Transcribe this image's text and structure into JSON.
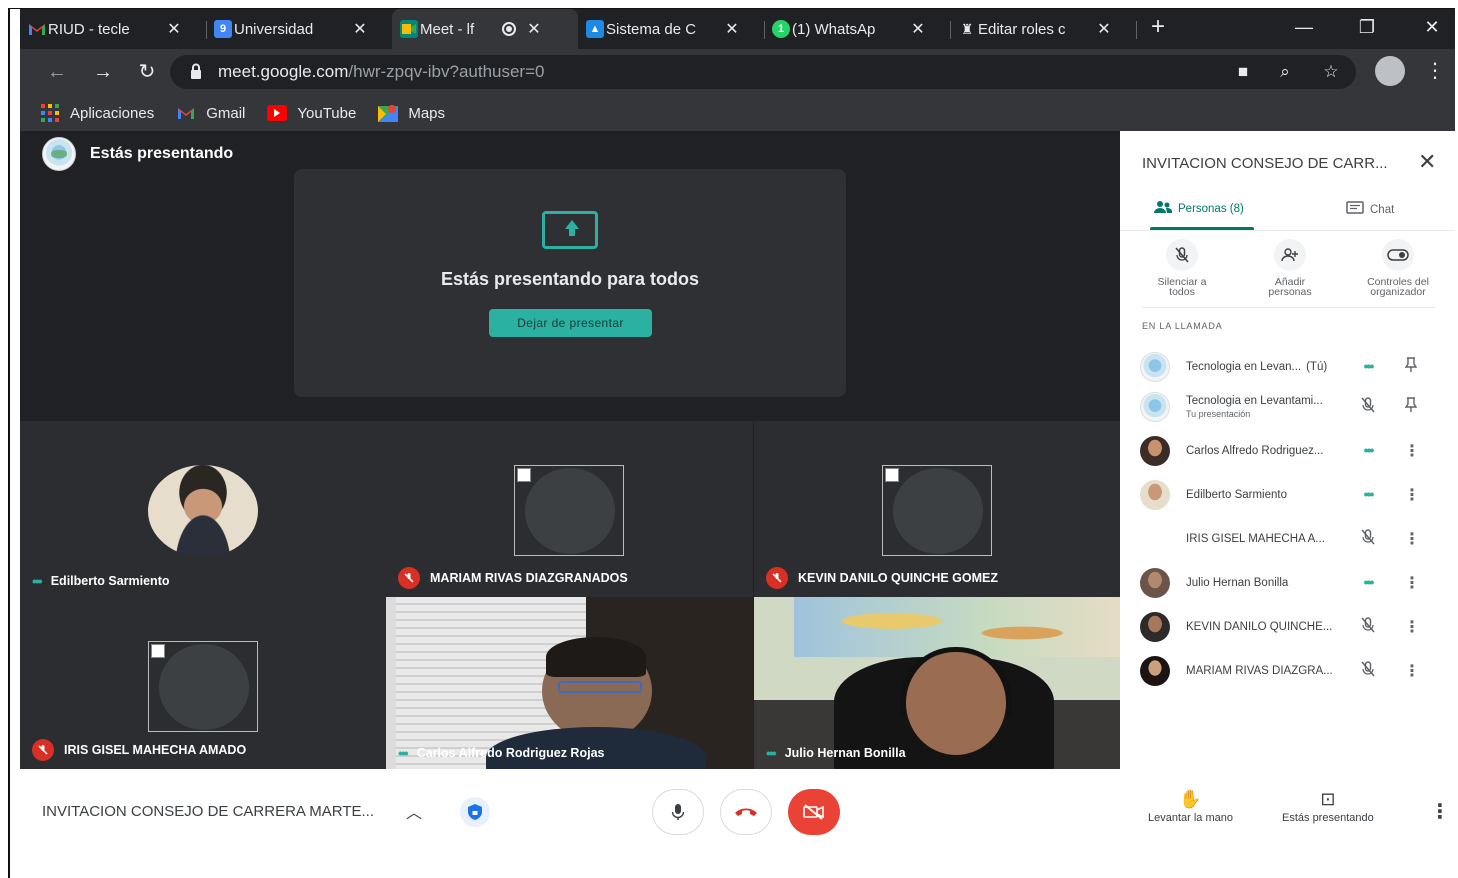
{
  "browser": {
    "tabs": [
      {
        "label": "RIUD - tecle",
        "icon": "gmail-icon",
        "color": "#ea4335"
      },
      {
        "label": "Universidad",
        "icon": "calendar-icon",
        "color": "#4285f4"
      },
      {
        "label": "Meet - lf",
        "icon": "meet-icon",
        "color": "#00897b"
      },
      {
        "label": "Sistema de C",
        "icon": "school-icon",
        "color": "#1e88e5"
      },
      {
        "label": "(1) WhatsAp",
        "icon": "whatsapp-icon",
        "color": "#25d366"
      },
      {
        "label": "Editar roles c",
        "icon": "person-icon",
        "color": "#ffffff"
      }
    ],
    "close_glyph": "✕",
    "new_tab_glyph": "+",
    "url_host": "meet.google.com",
    "url_path": "/hwr-zpqv-ibv?authuser=0",
    "bookmarks": [
      {
        "label": "Aplicaciones",
        "icon": "apps-grid-icon"
      },
      {
        "label": "Gmail",
        "icon": "gmail-icon"
      },
      {
        "label": "YouTube",
        "icon": "youtube-icon"
      },
      {
        "label": "Maps",
        "icon": "maps-icon"
      }
    ]
  },
  "stage": {
    "presenting_label": "Estás presentando",
    "card_title": "Estás presentando para todos",
    "stop_button": "Dejar de presentar",
    "tiles": [
      {
        "name": "Edilberto Sarmiento",
        "status": "speaking"
      },
      {
        "name": "MARIAM RIVAS DIAZGRANADOS",
        "status": "muted"
      },
      {
        "name": "KEVIN DANILO QUINCHE GOMEZ",
        "status": "muted"
      },
      {
        "name": "IRIS GISEL MAHECHA AMADO",
        "status": "muted"
      },
      {
        "name": "Carlos Alfredo Rodriguez Rojas",
        "status": "speaking"
      },
      {
        "name": "Julio Hernan Bonilla",
        "status": "speaking"
      }
    ]
  },
  "panel": {
    "title": "INVITACION CONSEJO DE CARR...",
    "tab_people": "Personas (8)",
    "tab_chat": "Chat",
    "actions": [
      {
        "line1": "Silenciar a",
        "line2": "todos",
        "icon": "mic-off-icon"
      },
      {
        "line1": "Añadir",
        "line2": "personas",
        "icon": "add-person-icon"
      },
      {
        "line1": "Controles del",
        "line2": "organizador",
        "icon": "toggle-icon"
      }
    ],
    "section_label": "EN LA LLAMADA",
    "you_suffix": "(Tú)",
    "people": [
      {
        "name": "Tecnologia en Levan...",
        "sub": "",
        "you": true,
        "status": "speaking",
        "trailing": "pin"
      },
      {
        "name": "Tecnologia en Levantami...",
        "sub": "Tu presentación",
        "you": false,
        "status": "presentation-muted",
        "trailing": "pin"
      },
      {
        "name": "Carlos Alfredo Rodriguez...",
        "sub": "",
        "you": false,
        "status": "speaking",
        "trailing": "more"
      },
      {
        "name": "Edilberto Sarmiento",
        "sub": "",
        "you": false,
        "status": "speaking",
        "trailing": "more"
      },
      {
        "name": "IRIS GISEL MAHECHA A...",
        "sub": "",
        "you": false,
        "status": "muted",
        "trailing": "more"
      },
      {
        "name": "Julio Hernan Bonilla",
        "sub": "",
        "you": false,
        "status": "speaking",
        "trailing": "more"
      },
      {
        "name": "KEVIN DANILO QUINCHE...",
        "sub": "",
        "you": false,
        "status": "muted",
        "trailing": "more"
      },
      {
        "name": "MARIAM RIVAS DIAZGRA...",
        "sub": "",
        "you": false,
        "status": "muted",
        "trailing": "more"
      }
    ]
  },
  "bottom": {
    "meeting_name": "INVITACION CONSEJO DE CARRERA MARTE...",
    "raise_hand": "Levantar la mano",
    "presenting": "Estás presentando"
  },
  "colors": {
    "accent": "#00796b",
    "teal": "#2ab1a1",
    "danger": "#d93025",
    "stage_bg": "#202124"
  }
}
